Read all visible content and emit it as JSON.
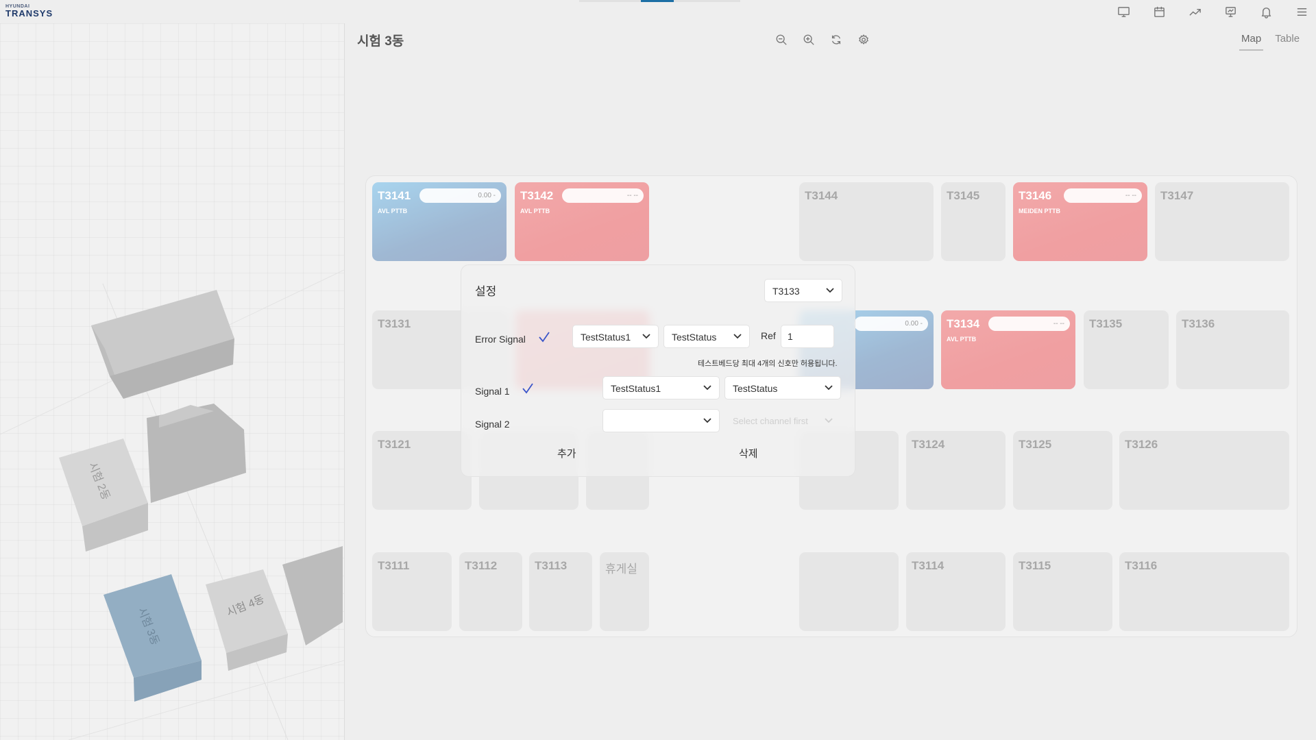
{
  "brand": {
    "line1": "HYUNDAI",
    "line2": "TRANSYS"
  },
  "top_icons": [
    "monitor-icon",
    "calendar-icon",
    "trend-icon",
    "presentation-icon",
    "bell-icon",
    "menu-icon"
  ],
  "left_panel": {
    "buildings": [
      {
        "label": "시험 2동",
        "color": "#cdcdcd"
      },
      {
        "label": "시험 3동",
        "color": "#93aec3"
      },
      {
        "label": "시험 4동",
        "color": "#cdcdcd"
      }
    ]
  },
  "main": {
    "title": "시험 3동",
    "tools": [
      "zoom-out-icon",
      "zoom-in-icon",
      "refresh-icon",
      "settings-icon"
    ],
    "view_tabs": [
      {
        "label": "Map",
        "active": true
      },
      {
        "label": "Table",
        "active": false
      }
    ]
  },
  "cells": {
    "t3141": {
      "name": "T3141",
      "sub": "AVL PTTB",
      "value": "0.00  -"
    },
    "t3142": {
      "name": "T3142",
      "sub": "AVL PTTB",
      "value": "--  --"
    },
    "t3144": {
      "name": "T3144"
    },
    "t3145": {
      "name": "T3145"
    },
    "t3146": {
      "name": "T3146",
      "sub": "MEIDEN PTTB",
      "value": "--  --"
    },
    "t3147": {
      "name": "T3147"
    },
    "t3131": {
      "name": "T3131"
    },
    "t3133": {
      "value": "0.00  -"
    },
    "t3134": {
      "name": "T3134",
      "sub": "AVL PTTB",
      "value": "--  --"
    },
    "t3135": {
      "name": "T3135"
    },
    "t3136": {
      "name": "T3136"
    },
    "t3121": {
      "name": "T3121"
    },
    "t3124": {
      "name": "T3124"
    },
    "t3125": {
      "name": "T3125"
    },
    "t3126": {
      "name": "T3126"
    },
    "t3111": {
      "name": "T3111"
    },
    "t3112": {
      "name": "T3112"
    },
    "t3113": {
      "name": "T3113"
    },
    "lounge": {
      "name": "휴게실"
    },
    "t3114": {
      "name": "T3114"
    },
    "t3115": {
      "name": "T3115"
    },
    "t3116": {
      "name": "T3116"
    }
  },
  "modal": {
    "title": "설정",
    "cell_select": "T3133",
    "error_signal": {
      "label": "Error Signal",
      "checked": true,
      "select1": "TestStatus1",
      "select2": "TestStatus",
      "ref_label": "Ref",
      "ref_value": "1"
    },
    "note": "테스트베드당 최대 4개의 신호만 허용됩니다.",
    "signal1": {
      "label": "Signal 1",
      "checked": true,
      "select1": "TestStatus1",
      "select2": "TestStatus"
    },
    "signal2": {
      "label": "Signal 2",
      "select1": "",
      "select2_placeholder": "Select channel first"
    },
    "add_label": "추가",
    "delete_label": "삭제"
  },
  "colors": {
    "accent": "#1d6fa5",
    "check": "#3b55c9",
    "cell_blue": "#a8d4ee",
    "cell_red": "#f2a9aa",
    "building_active": "#93aec3"
  }
}
